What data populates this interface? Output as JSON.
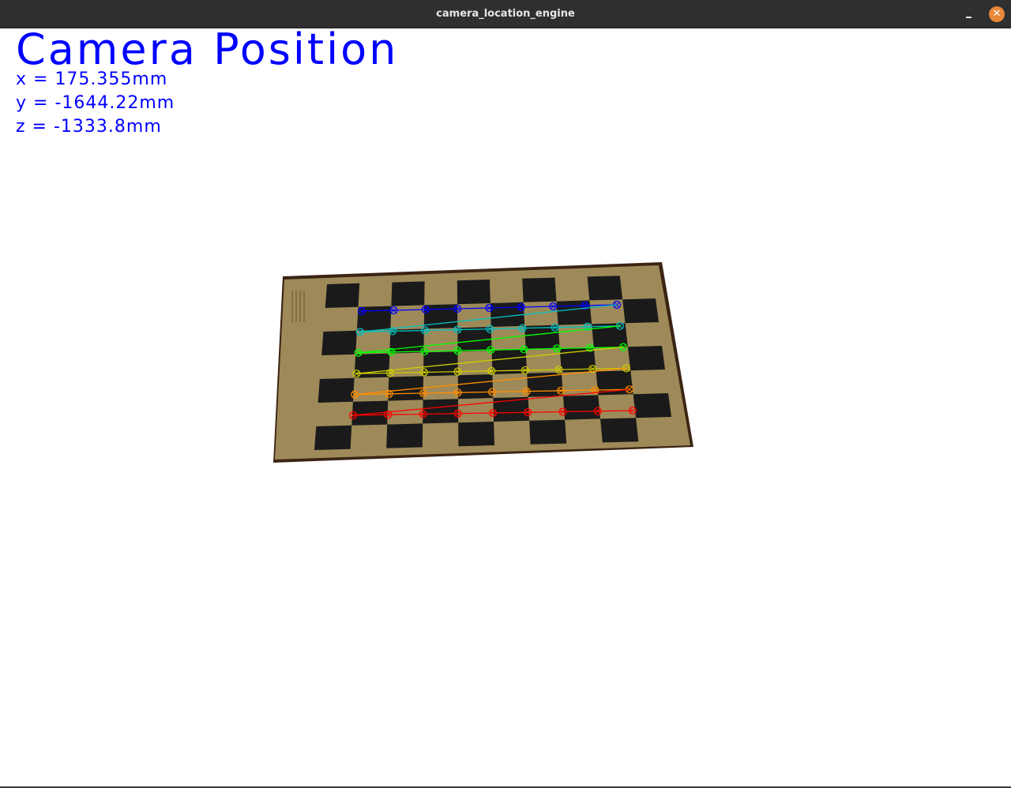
{
  "window": {
    "title": "camera_location_engine"
  },
  "titlebar_buttons": {
    "minimize_icon": "minimize-icon",
    "close_icon": "close-icon",
    "close_color": "#e8883a"
  },
  "overlay": {
    "heading": "Camera Position",
    "x": "x = 175.355mm",
    "y": "y = -1644.22mm",
    "z": "z = -1333.8mm",
    "text_color": "#0000ff"
  },
  "checkerboard": {
    "paper_color": "#9e8a59",
    "square_color": "#1a1a1a",
    "row_colors": [
      "#0000ff",
      "#00bfbf",
      "#00ff00",
      "#cccc00",
      "#ff8c00",
      "#ff0000"
    ],
    "inner_corner_cols": 9,
    "inner_corner_rows": 6
  }
}
